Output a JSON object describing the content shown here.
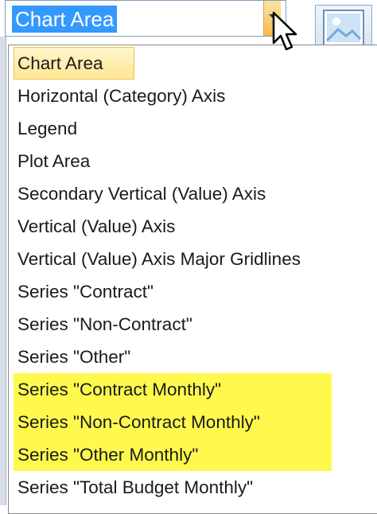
{
  "combo": {
    "value": "Chart Area"
  },
  "dropdown": {
    "items": [
      {
        "label": "Chart Area"
      },
      {
        "label": "Horizontal (Category) Axis"
      },
      {
        "label": "Legend"
      },
      {
        "label": "Plot Area"
      },
      {
        "label": "Secondary Vertical (Value) Axis"
      },
      {
        "label": "Vertical (Value) Axis"
      },
      {
        "label": "Vertical (Value) Axis Major Gridlines"
      },
      {
        "label": "Series \"Contract\""
      },
      {
        "label": "Series \"Non-Contract\""
      },
      {
        "label": "Series \"Other\""
      },
      {
        "label": "Series \"Contract Monthly\""
      },
      {
        "label": "Series \"Non-Contract Monthly\""
      },
      {
        "label": "Series \"Other Monthly\""
      },
      {
        "label": "Series \"Total Budget Monthly\""
      }
    ],
    "selected_item": "Chart Area",
    "highlighted_items": [
      "Series \"Contract Monthly\"",
      "Series \"Non-Contract Monthly\"",
      "Series \"Other Monthly\""
    ]
  },
  "icons": [
    "chevron-down-icon",
    "mouse-cursor-icon",
    "picture-icon"
  ],
  "colors": {
    "selection_blue": "#3399ff",
    "hover_gold": "#ffe694",
    "highlight_yellow": "#fff94d"
  }
}
